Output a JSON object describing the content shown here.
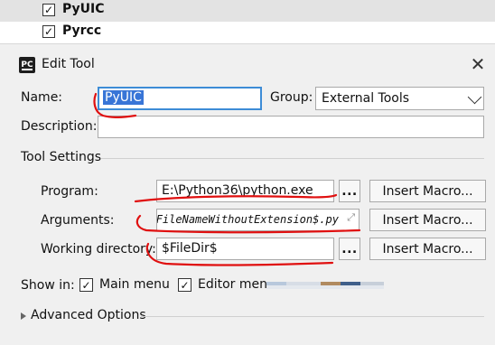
{
  "background_tree": {
    "items": [
      {
        "label": "PyUIC",
        "checked": true
      },
      {
        "label": "Pyrcc",
        "checked": true
      }
    ]
  },
  "dialog": {
    "title": "Edit Tool",
    "icon_text": "PC",
    "close_icon": "close-icon",
    "name_label": "Name:",
    "name_value": "PyUIC",
    "group_label": "Group:",
    "group_value": "External Tools",
    "description_label": "Description:",
    "description_value": "",
    "tool_settings_header": "Tool Settings",
    "program_label": "Program:",
    "program_value": "E:\\Python36\\python.exe",
    "arguments_label": "Arguments:",
    "arguments_value": "$FileNameWithoutExtension$.py",
    "working_dir_label": "Working directory:",
    "working_dir_value": "$FileDir$",
    "browse_label": "...",
    "insert_macro_label": "Insert Macro...",
    "show_in_label": "Show in:",
    "main_menu_label": "Main menu",
    "main_menu_checked": true,
    "editor_menu_label": "Editor menu",
    "editor_menu_checked": true,
    "advanced_label": "Advanced Options"
  },
  "colors": {
    "selection": "#3875d7",
    "focus_border": "#3d8cd6",
    "annotation": "#e01010"
  }
}
